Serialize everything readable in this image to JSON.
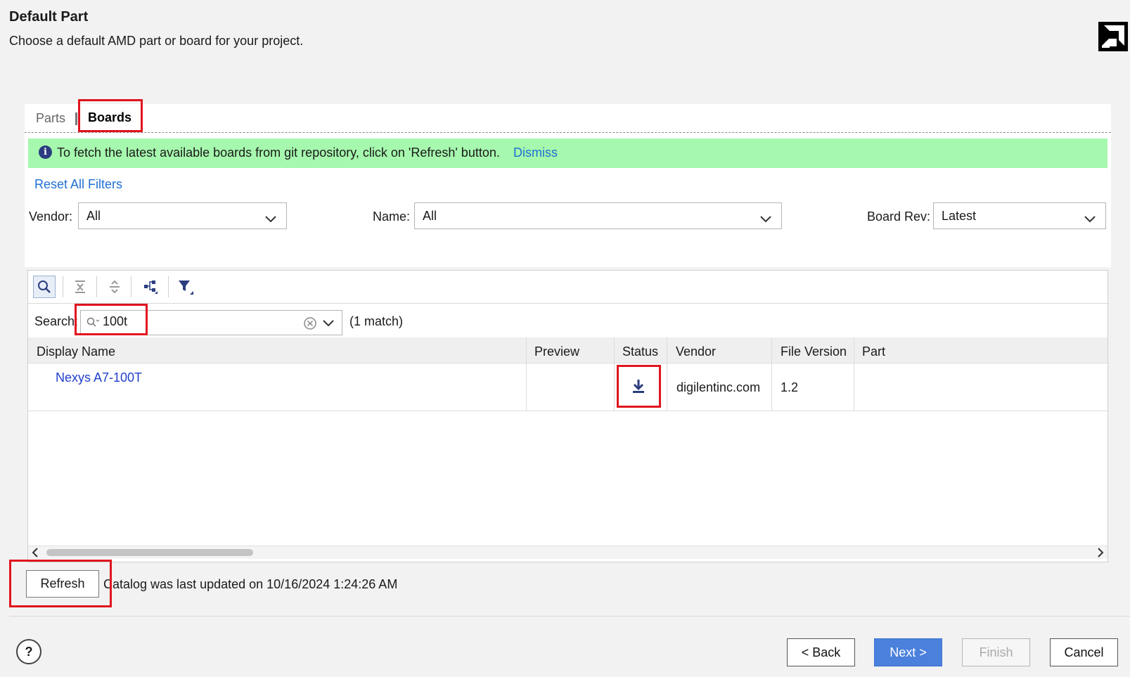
{
  "header": {
    "title": "Default Part",
    "subtitle": "Choose a default AMD part or board for your project.",
    "logo_icon": "amd-logo-icon"
  },
  "tabs": [
    {
      "label": "Parts",
      "active": false
    },
    {
      "label": "Boards",
      "active": true
    }
  ],
  "banner": {
    "icon": "info-icon",
    "text": "To fetch the latest available boards from git repository, click on 'Refresh' button.",
    "dismiss": "Dismiss",
    "color": "#a6f8ae"
  },
  "filters": {
    "reset_label": "Reset All Filters",
    "vendor": {
      "label": "Vendor:",
      "value": "All"
    },
    "name": {
      "label": "Name:",
      "value": "All"
    },
    "board_rev": {
      "label": "Board Rev:",
      "value": "Latest"
    }
  },
  "toolbar": {
    "icons": [
      "search-icon",
      "collapse-all-icon",
      "expand-all-icon",
      "hierarchy-icon",
      "filter-icon"
    ]
  },
  "search": {
    "label": "Search:",
    "value": "100t",
    "match_text": "(1 match)"
  },
  "table": {
    "columns": [
      "Display Name",
      "Preview",
      "Status",
      "Vendor",
      "File Version",
      "Part"
    ],
    "rows": [
      {
        "display_name": "Nexys A7-100T",
        "preview": "",
        "status": "download-icon",
        "vendor": "digilentinc.com",
        "file_version": "1.2",
        "part": ""
      }
    ]
  },
  "refresh": {
    "label": "Refresh",
    "catalog_text": "Catalog was last updated on 10/16/2024 1:24:26 AM"
  },
  "footer": {
    "help": "?",
    "back": "< Back",
    "next": "Next >",
    "finish": "Finish",
    "cancel": "Cancel"
  },
  "colors": {
    "accent": "#4b80dc",
    "link": "#1f6fd1",
    "highlight": "#e0141e"
  }
}
